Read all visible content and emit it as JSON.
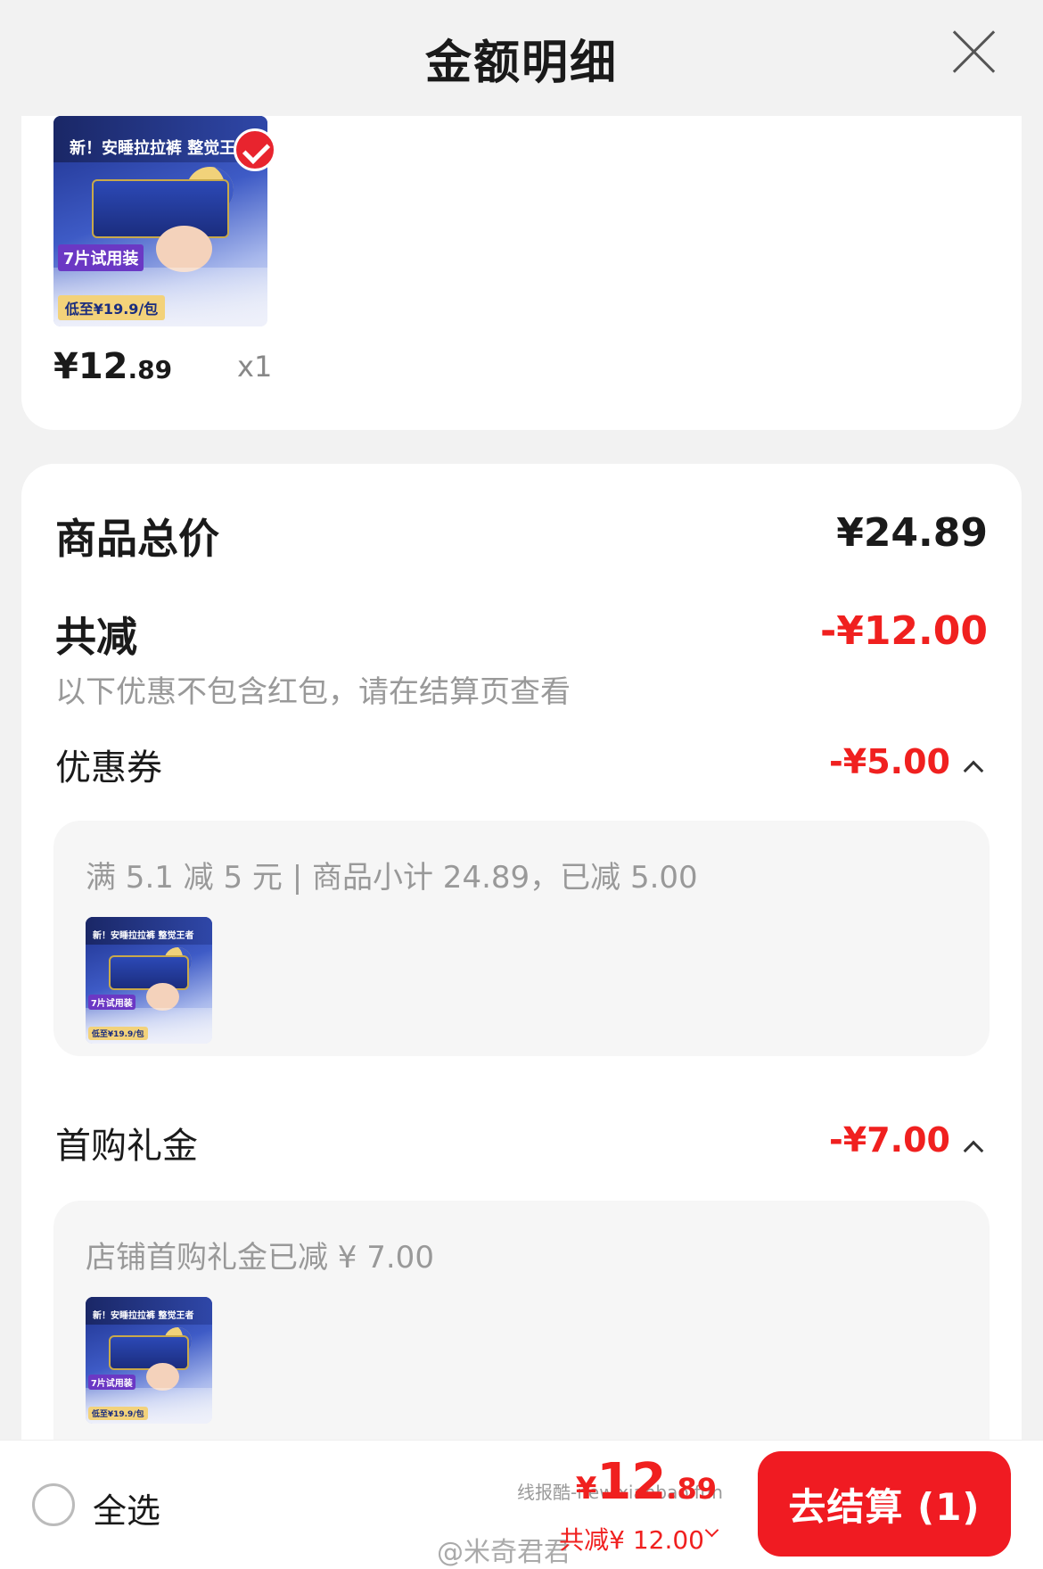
{
  "header": {
    "title": "金额明细"
  },
  "product": {
    "thumb_banner": "新！安睡拉拉裤 整觉王者",
    "thumb_tag": "7片试用装",
    "thumb_price": "低至¥19.9/包",
    "price_main": "¥12",
    "price_decimal": ".89",
    "quantity": "x1"
  },
  "summary": {
    "total_label": "商品总价",
    "total_value": "¥24.89",
    "reduce_label": "共减",
    "reduce_value": "-¥12.00",
    "reduce_note": "以下优惠不包含红包，请在结算页查看"
  },
  "coupon": {
    "title": "优惠券",
    "amount": "-¥5.00",
    "detail": "满 5.1 减 5 元 | 商品小计 24.89，已减 5.00"
  },
  "first_purchase": {
    "title": "首购礼金",
    "amount": "-¥7.00",
    "detail": "店铺首购礼金已减 ¥ 7.00"
  },
  "bottom": {
    "select_all": "全选",
    "currency": "¥",
    "total_int": "12",
    "total_dec": ".89",
    "reduce": "共减¥ 12.00",
    "checkout": "去结算 (1)",
    "watermark_site": "线报酷-new.xianbao.fun",
    "watermark_user": "@米奇君君"
  },
  "colors": {
    "accent_red": "#f0201f",
    "button_red": "#f01b22",
    "muted": "#999999"
  },
  "icons": [
    "close-icon",
    "check-circle-icon",
    "chevron-up-icon",
    "chevron-down-icon",
    "radio-icon"
  ]
}
